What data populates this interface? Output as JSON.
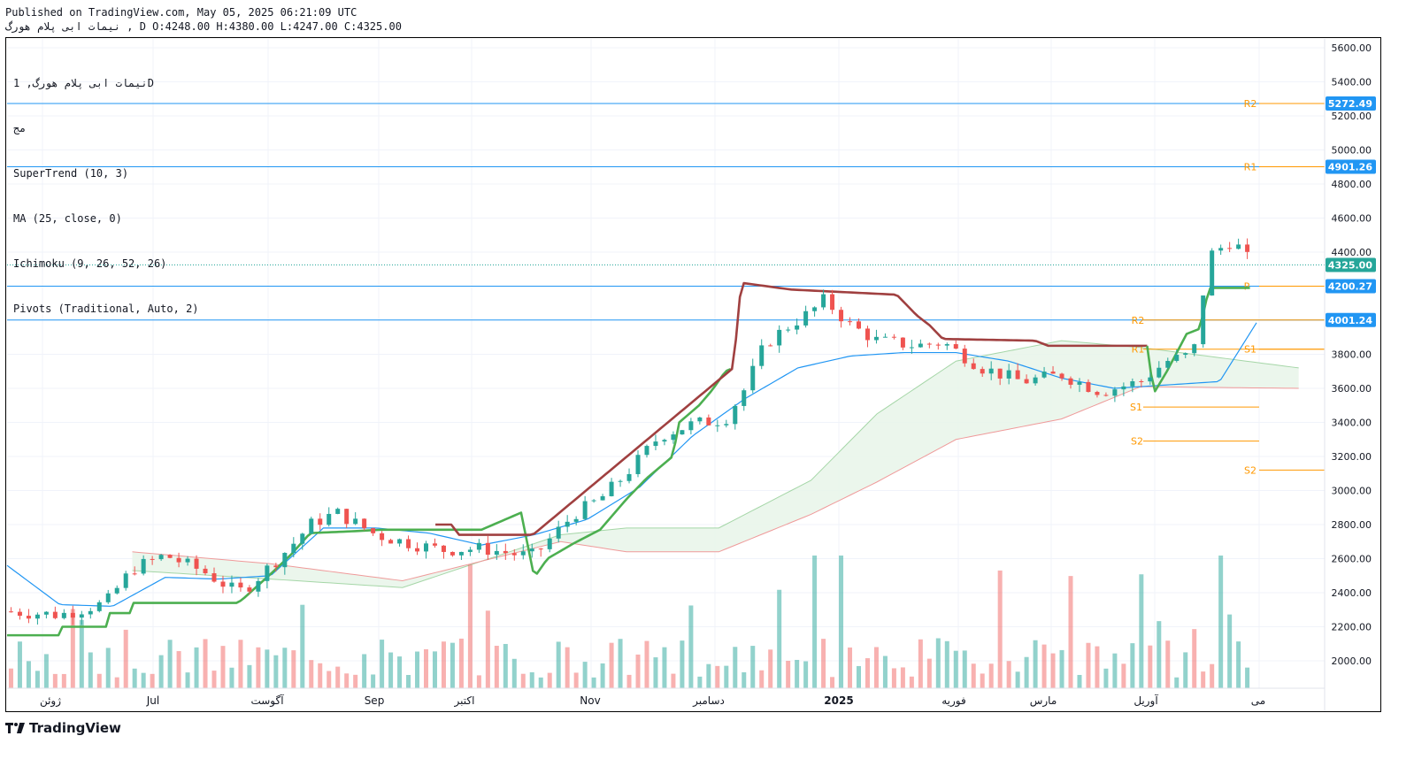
{
  "header": {
    "published_line": "Published on TradingView.com, May 05, 2025 06:21:09 UTC",
    "symbol_line": "نیمات ابی پلام هورگ , D O:4248.00 H:4380.00 L:4247.00 C:4325.00"
  },
  "legend": {
    "symbol": "نیمات ابی پلام هورگ, 1D",
    "exchange": "مج",
    "indicators": [
      "SuperTrend (10, 3)",
      "MA (25, close, 0)",
      "Ichimoku (9, 26, 52, 26)",
      "Pivots (Traditional, Auto, 2)"
    ]
  },
  "brand": {
    "name": "TradingView"
  },
  "colors": {
    "up": "#26a69a",
    "down": "#ef5350",
    "supertrend_up": "#4caf50",
    "supertrend_down": "#a04040",
    "ma": "#2196f3",
    "pivot": "#ff9800",
    "hline": "#2962ff",
    "cloud_green": "#e8f5e9",
    "cloud_red": "#fce4e4"
  },
  "chart_data": {
    "type": "candlestick",
    "ylim": [
      1850,
      5700
    ],
    "y_ticks": [
      2000,
      2200,
      2400,
      2600,
      2800,
      3000,
      3200,
      3400,
      3600,
      3800,
      4000,
      4200,
      4400,
      4600,
      4800,
      5000,
      5200,
      5400,
      5600
    ],
    "y_tick_labels": [
      "2000.00",
      "2200.00",
      "2400.00",
      "2600.00",
      "2800.00",
      "3000.00",
      "3200.00",
      "3400.00",
      "3600.00",
      "3800.00",
      "4000.00",
      "4200.00",
      "4400.00",
      "4600.00",
      "4800.00",
      "5000.00",
      "5200.00",
      "5400.00",
      "5600.00"
    ],
    "x_tick_labels": [
      "ژوئن",
      "Jul",
      "آگوست",
      "Sep",
      "اکتبر",
      "Nov",
      "دسامبر",
      "2025",
      "فوریه",
      "مارس",
      "آوریل",
      "می"
    ],
    "price_labels": [
      {
        "value": 5272.49,
        "label": "5272.49",
        "color": "#2196f3"
      },
      {
        "value": 4901.26,
        "label": "4901.26",
        "color": "#2196f3"
      },
      {
        "value": 4325.0,
        "label": "4325.00",
        "color": "#26a69a"
      },
      {
        "value": 4200.27,
        "label": "4200.27",
        "color": "#2196f3"
      },
      {
        "value": 4001.24,
        "label": "4001.24",
        "color": "#2196f3"
      }
    ],
    "pivot_labels": [
      "R2",
      "R1",
      "P",
      "R2",
      "R1",
      "S1",
      "S1",
      "S2",
      "S2"
    ],
    "last_close": 4325.0,
    "ohlc": {
      "open": 4248.0,
      "high": 4380.0,
      "low": 4247.0,
      "close": 4325.0
    },
    "supertrend_anchors": [
      [
        0,
        2150
      ],
      [
        21,
        2150
      ],
      [
        39,
        2150
      ],
      [
        40,
        2200
      ],
      [
        75,
        2200
      ],
      [
        76,
        2280
      ],
      [
        95,
        2280
      ],
      [
        96,
        2340
      ],
      [
        120,
        2340
      ],
      [
        155,
        2340
      ],
      [
        175,
        2340
      ],
      [
        180,
        2370
      ],
      [
        200,
        2510
      ],
      [
        215,
        2620
      ],
      [
        230,
        2750
      ],
      [
        260,
        2760
      ],
      [
        285,
        2770
      ],
      [
        320,
        2770
      ],
      [
        360,
        2770
      ],
      [
        390,
        2870
      ],
      [
        395,
        2680
      ],
      [
        400,
        2490
      ],
      [
        410,
        2600
      ],
      [
        430,
        2690
      ],
      [
        450,
        2770
      ],
      [
        470,
        2950
      ],
      [
        485,
        3070
      ],
      [
        505,
        3200
      ],
      [
        510,
        3400
      ],
      [
        525,
        3500
      ],
      [
        535,
        3590
      ],
      [
        545,
        3700
      ],
      [
        551,
        3720
      ]
    ],
    "supertrend_down_anchors": [
      [
        325,
        2800
      ],
      [
        338,
        2800
      ],
      [
        342,
        2740
      ],
      [
        355,
        2740
      ],
      [
        395,
        2740
      ],
      [
        399,
        2740
      ],
      [
        551,
        3720
      ],
      [
        557,
        4220
      ],
      [
        595,
        4180
      ],
      [
        675,
        4150
      ],
      [
        690,
        4030
      ],
      [
        700,
        3970
      ],
      [
        710,
        3890
      ],
      [
        780,
        3880
      ],
      [
        790,
        3850
      ],
      [
        865,
        3850
      ]
    ],
    "supertrend_up2_anchors": [
      [
        865,
        3850
      ],
      [
        870,
        3570
      ],
      [
        880,
        3700
      ],
      [
        895,
        3920
      ],
      [
        905,
        3950
      ],
      [
        912,
        4190
      ],
      [
        945,
        4190
      ]
    ],
    "ma_anchors": [
      [
        0,
        2560
      ],
      [
        40,
        2330
      ],
      [
        80,
        2320
      ],
      [
        120,
        2490
      ],
      [
        160,
        2480
      ],
      [
        200,
        2500
      ],
      [
        240,
        2780
      ],
      [
        280,
        2780
      ],
      [
        320,
        2750
      ],
      [
        360,
        2680
      ],
      [
        400,
        2740
      ],
      [
        440,
        2830
      ],
      [
        480,
        3020
      ],
      [
        520,
        3320
      ],
      [
        560,
        3540
      ],
      [
        600,
        3720
      ],
      [
        640,
        3790
      ],
      [
        680,
        3810
      ],
      [
        720,
        3810
      ],
      [
        760,
        3760
      ],
      [
        800,
        3660
      ],
      [
        840,
        3600
      ],
      [
        880,
        3620
      ],
      [
        920,
        3640
      ],
      [
        950,
        4010
      ]
    ],
    "volume_note": "relative volume bars along the bottom"
  }
}
